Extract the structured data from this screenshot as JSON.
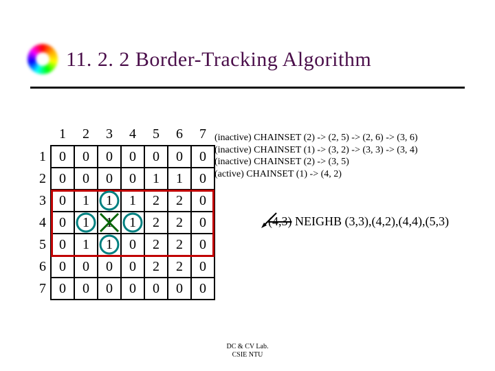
{
  "title": "11. 2. 2 Border-Tracking Algorithm",
  "col_headers": [
    "1",
    "2",
    "3",
    "4",
    "5",
    "6",
    "7"
  ],
  "row_headers": [
    "1",
    "2",
    "3",
    "4",
    "5",
    "6",
    "7"
  ],
  "grid": [
    [
      "0",
      "0",
      "0",
      "0",
      "0",
      "0",
      "0"
    ],
    [
      "0",
      "0",
      "0",
      "0",
      "1",
      "1",
      "0"
    ],
    [
      "0",
      "1",
      "1",
      "1",
      "2",
      "2",
      "0"
    ],
    [
      "0",
      "1",
      "1",
      "1",
      "2",
      "2",
      "0"
    ],
    [
      "0",
      "1",
      "1",
      "0",
      "2",
      "2",
      "0"
    ],
    [
      "0",
      "0",
      "0",
      "0",
      "2",
      "2",
      "0"
    ],
    [
      "0",
      "0",
      "0",
      "0",
      "0",
      "0",
      "0"
    ]
  ],
  "chainset": {
    "line1": "(inactive) CHAINSET (2) -> (2, 5) -> (2, 6) -> (3, 6)",
    "line2": "(inactive) CHAINSET (1) -> (3, 2) -> (3, 3) -> (3, 4)",
    "line3": "(inactive) CHAINSET (2) -> (3, 5)",
    "line4": "(active) CHAINSET (1) -> (4, 2)"
  },
  "neighb_struck": "(4,3)",
  "neighb_rest": " NEIGHB (3,3),(4,2),(4,4),(5,3)",
  "footer_line1": "DC & CV Lab.",
  "footer_line2": "CSIE NTU"
}
